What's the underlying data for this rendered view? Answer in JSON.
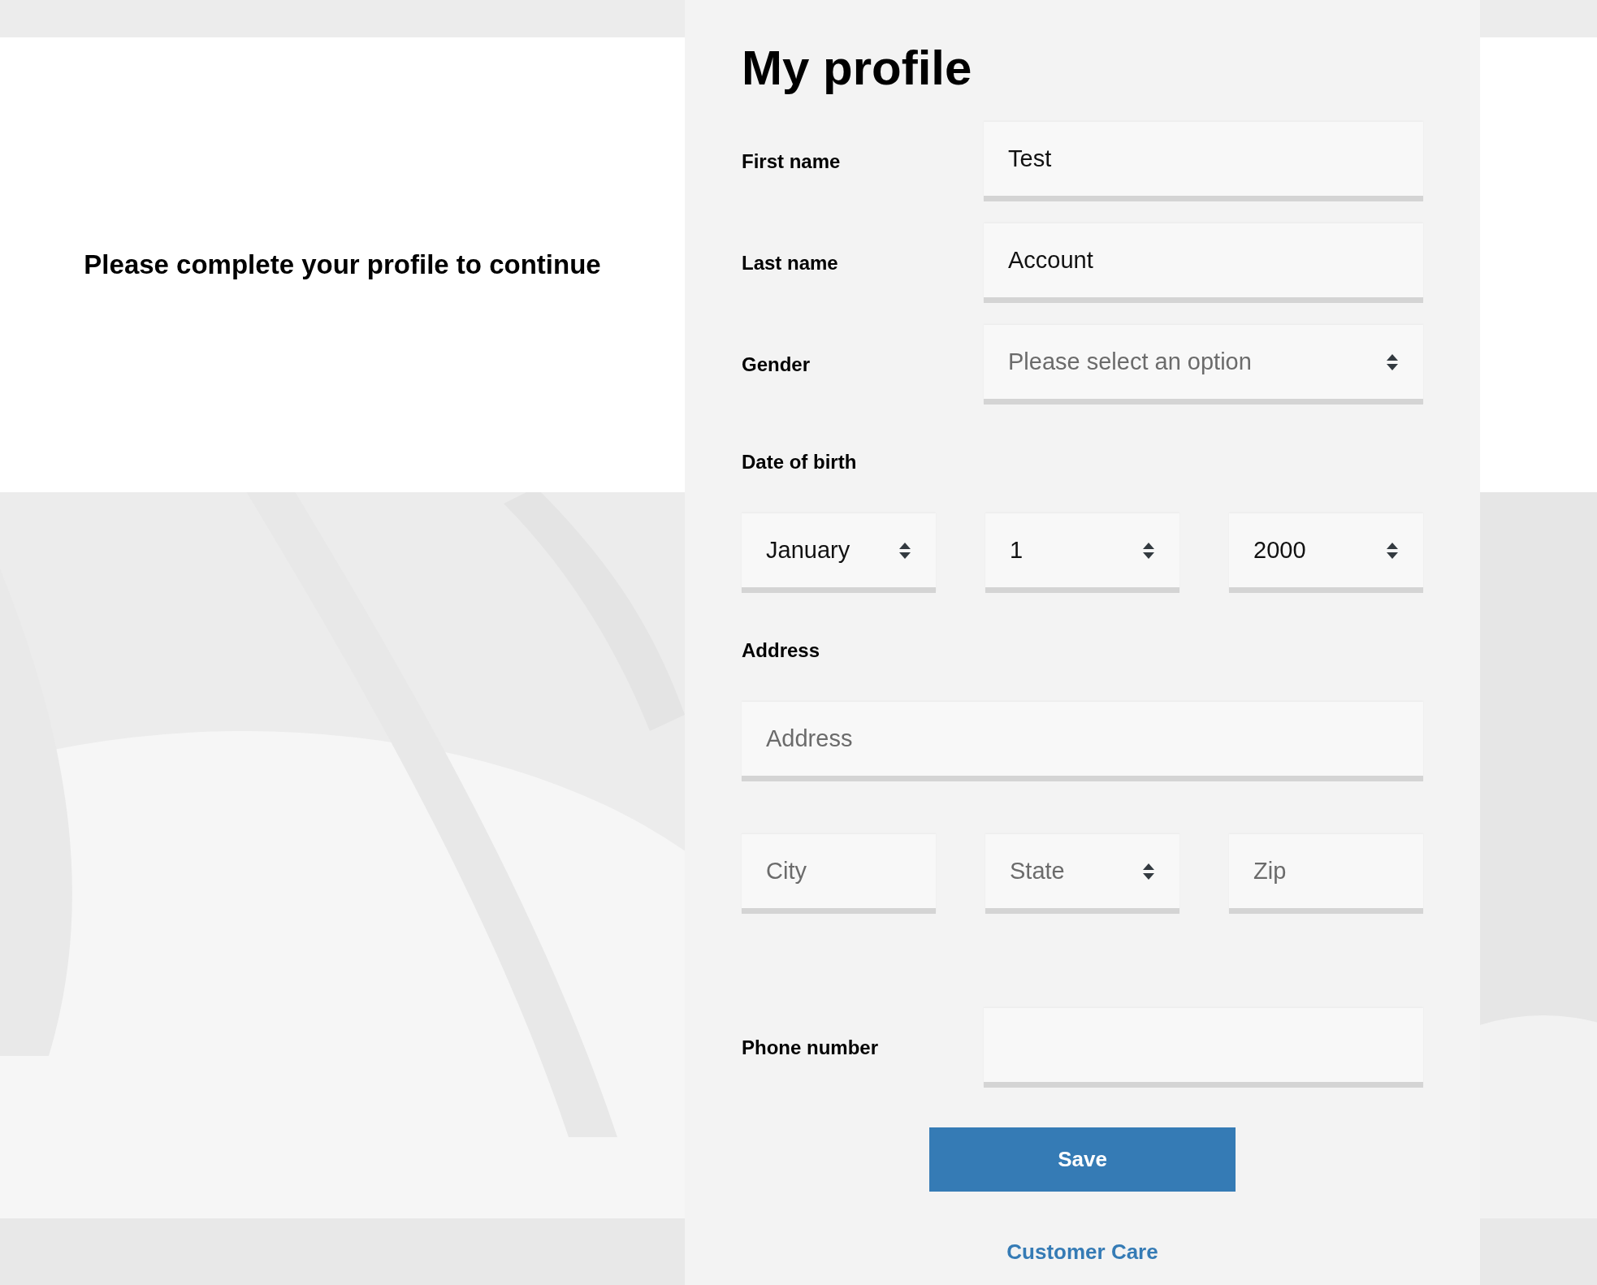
{
  "intro": "Please complete your profile to continue",
  "form": {
    "title": "My profile",
    "name_fields": [
      {
        "label": "First name",
        "kind": "input",
        "value": "Test"
      },
      {
        "label": "Last name",
        "kind": "input",
        "value": "Account"
      },
      {
        "label": "Gender",
        "kind": "select",
        "placeholder": "Please select an option"
      }
    ],
    "date_of_birth": {
      "label": "Date of birth",
      "parts": [
        {
          "kind": "select",
          "value": "January"
        },
        {
          "kind": "select",
          "value": "1"
        },
        {
          "kind": "select",
          "value": "2000"
        }
      ]
    },
    "address": {
      "label": "Address",
      "line": {
        "kind": "input",
        "placeholder": "Address"
      },
      "parts": [
        {
          "kind": "input",
          "placeholder": "City"
        },
        {
          "kind": "select",
          "placeholder": "State"
        },
        {
          "kind": "input",
          "placeholder": "Zip"
        }
      ]
    },
    "phone": {
      "label": "Phone number",
      "kind": "input"
    },
    "save_button": "Save",
    "link": "Customer Care"
  }
}
